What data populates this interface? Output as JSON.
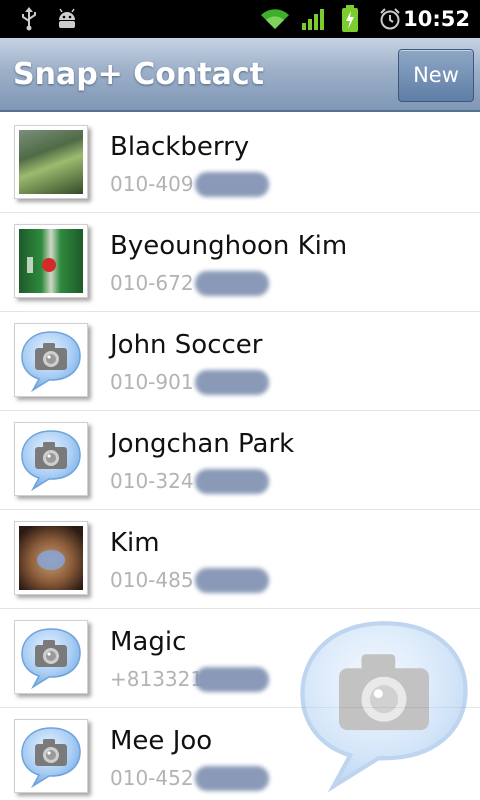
{
  "status_bar": {
    "time": "10:52",
    "icons": [
      "usb-icon",
      "android-debug-icon",
      "wifi-icon",
      "signal-icon",
      "battery-charging-icon",
      "alarm-icon"
    ]
  },
  "app": {
    "title": "Snap+ Contact",
    "new_button": "New"
  },
  "contacts": [
    {
      "name": "Blackberry",
      "phone": "010-409",
      "photo": "plant-photo"
    },
    {
      "name": "Byeounghoon Kim",
      "phone": "010-672",
      "photo": "beer-photo"
    },
    {
      "name": "John Soccer",
      "phone": "010-901",
      "photo": "camera-bubble-icon"
    },
    {
      "name": "Jongchan Park",
      "phone": "010-324",
      "photo": "camera-bubble-icon"
    },
    {
      "name": "Kim",
      "phone": "010-485",
      "photo": "person-photo"
    },
    {
      "name": "Magic",
      "phone": "+813321",
      "photo": "camera-bubble-icon"
    },
    {
      "name": "Mee Joo",
      "phone": "010-452",
      "photo": "camera-bubble-icon"
    }
  ],
  "colors": {
    "titlebar_top": "#c6d3e3",
    "titlebar_bottom": "#7f97b6",
    "name_text": "#111111",
    "phone_text": "#b3b3b3",
    "redaction": "#7d8fb0"
  }
}
